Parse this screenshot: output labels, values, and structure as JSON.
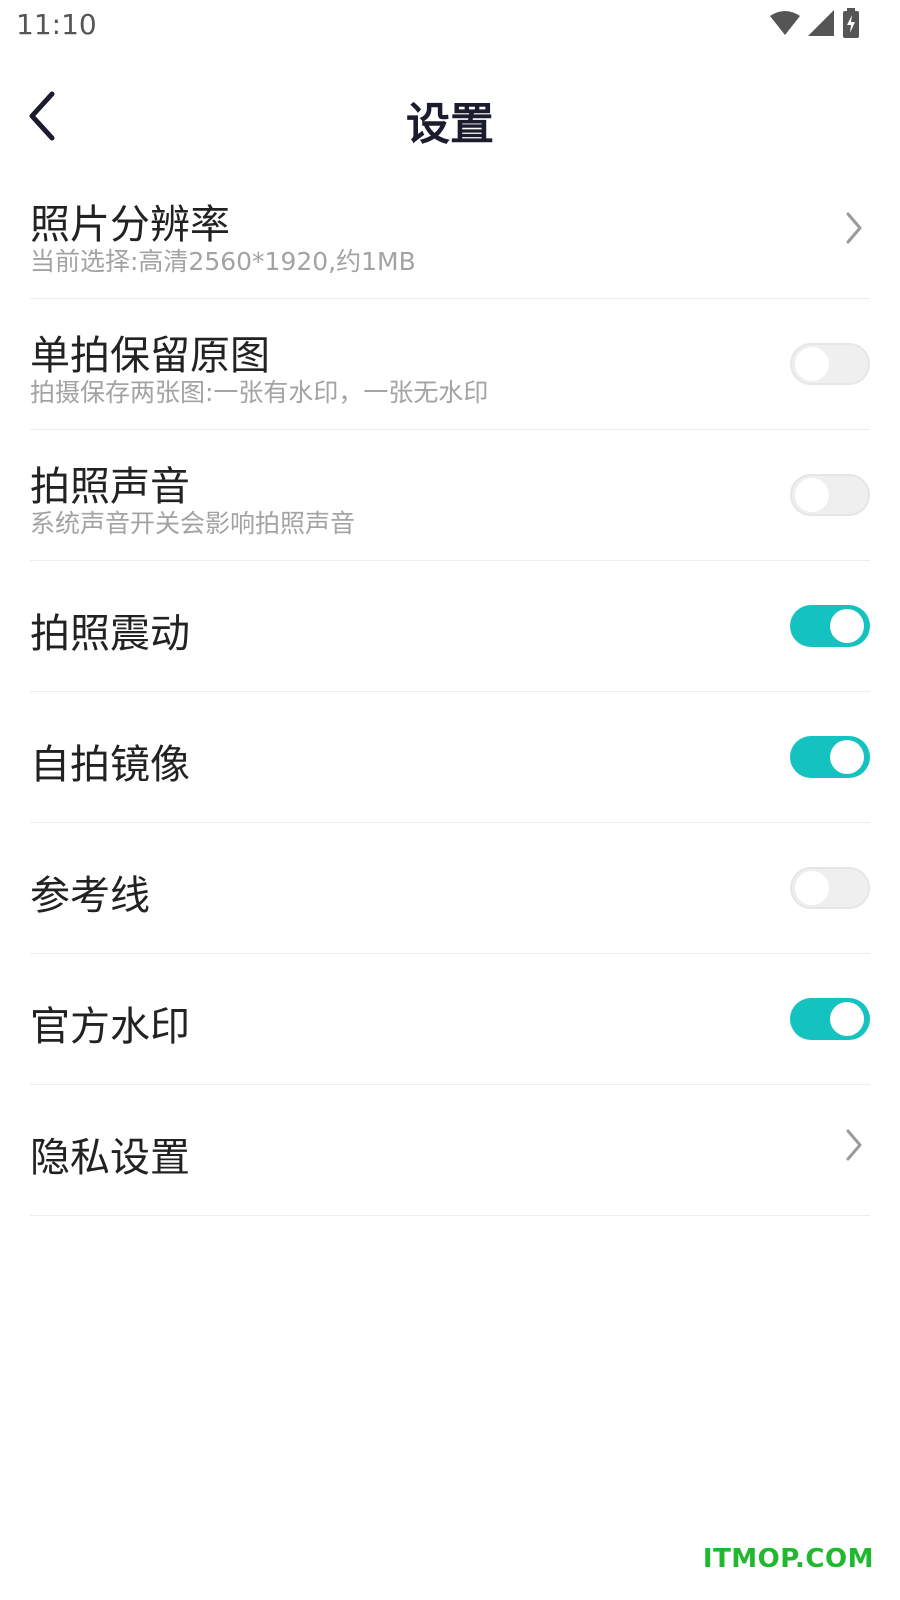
{
  "status_bar": {
    "time": "11:10"
  },
  "header": {
    "title": "设置"
  },
  "settings": [
    {
      "title": "照片分辨率",
      "subtitle": "当前选择:高清2560*1920,约1MB",
      "control": "chevron"
    },
    {
      "title": "单拍保留原图",
      "subtitle": "拍摄保存两张图:一张有水印，一张无水印",
      "control": "toggle",
      "on": false
    },
    {
      "title": "拍照声音",
      "subtitle": "系统声音开关会影响拍照声音",
      "control": "toggle",
      "on": false
    },
    {
      "title": "拍照震动",
      "control": "toggle",
      "on": true
    },
    {
      "title": "自拍镜像",
      "control": "toggle",
      "on": true
    },
    {
      "title": "参考线",
      "control": "toggle",
      "on": false
    },
    {
      "title": "官方水印",
      "control": "toggle",
      "on": true
    },
    {
      "title": "隐私设置",
      "control": "chevron"
    }
  ],
  "watermark": "ITMOP.COM",
  "colors": {
    "accent": "#14c3c0",
    "title": "#1b1c2e",
    "watermark": "#1fb82f"
  }
}
